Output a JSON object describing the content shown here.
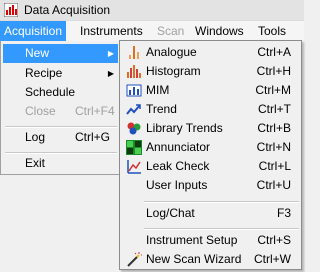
{
  "window": {
    "title": "Data Acquisition"
  },
  "menubar": {
    "items": [
      {
        "label": "Acquisition",
        "state": "active"
      },
      {
        "label": "Instruments",
        "state": "normal"
      },
      {
        "label": "Scan",
        "state": "disabled"
      },
      {
        "label": "Windows",
        "state": "normal"
      },
      {
        "label": "Tools",
        "state": "normal"
      }
    ]
  },
  "acquisition_menu": {
    "items": [
      {
        "label": "New",
        "shortcut": "",
        "submenu": true,
        "selected": true
      },
      {
        "label": "Recipe",
        "shortcut": "",
        "submenu": true
      },
      {
        "label": "Schedule",
        "shortcut": ""
      },
      {
        "label": "Close",
        "shortcut": "Ctrl+F4",
        "disabled": true
      },
      {
        "label": "Log",
        "shortcut": "Ctrl+G"
      },
      {
        "label": "Exit",
        "shortcut": ""
      }
    ]
  },
  "new_submenu": {
    "items": [
      {
        "label": "Analogue",
        "shortcut": "Ctrl+A",
        "icon": "analogue-icon"
      },
      {
        "label": "Histogram",
        "shortcut": "Ctrl+H",
        "icon": "histogram-icon"
      },
      {
        "label": "MIM",
        "shortcut": "Ctrl+M",
        "icon": "mim-icon"
      },
      {
        "label": "Trend",
        "shortcut": "Ctrl+T",
        "icon": "trend-icon"
      },
      {
        "label": "Library Trends",
        "shortcut": "Ctrl+B",
        "icon": "library-trends-icon"
      },
      {
        "label": "Annunciator",
        "shortcut": "Ctrl+N",
        "icon": "annunciator-icon"
      },
      {
        "label": "Leak Check",
        "shortcut": "Ctrl+L",
        "icon": "leak-check-icon"
      },
      {
        "label": "User Inputs",
        "shortcut": "Ctrl+U",
        "icon": ""
      },
      {
        "label": "Log/Chat",
        "shortcut": "F3",
        "icon": ""
      },
      {
        "label": "Instrument Setup",
        "shortcut": "Ctrl+S",
        "icon": ""
      },
      {
        "label": "New Scan Wizard",
        "shortcut": "Ctrl+W",
        "icon": "scan-wizard-icon"
      }
    ]
  },
  "colors": {
    "highlight": "#3399ff",
    "disabled_text": "#a0a0a0"
  }
}
